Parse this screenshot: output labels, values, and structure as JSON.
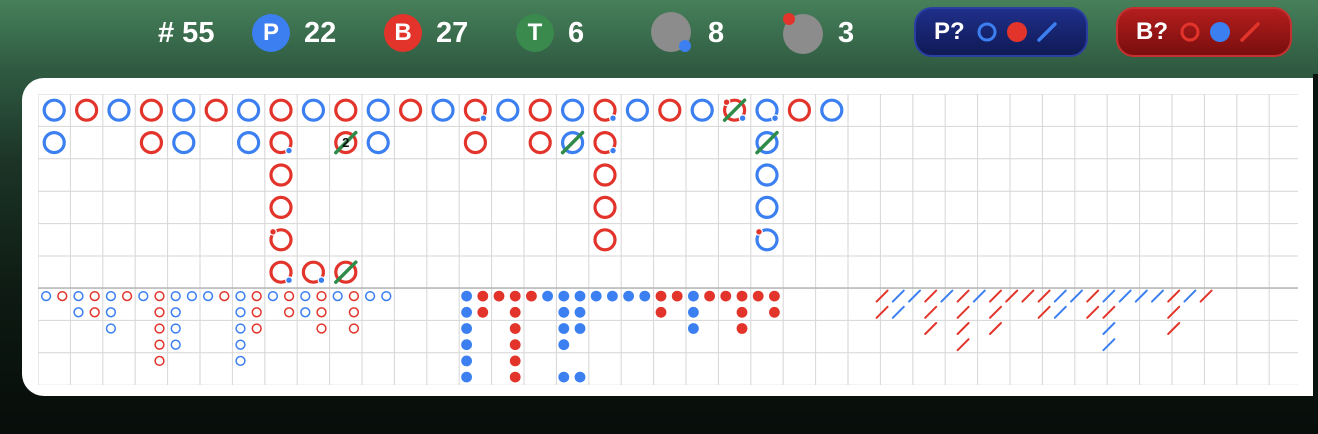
{
  "header": {
    "round": {
      "label": "# 55"
    },
    "player": {
      "badge": "P",
      "count": "22",
      "color": "#3b7ff1"
    },
    "banker": {
      "badge": "B",
      "count": "27",
      "color": "#e2342b"
    },
    "tie": {
      "badge": "T",
      "count": "6",
      "color": "#3a8a4d"
    },
    "player_pair": {
      "count": "8",
      "icon": "grey-disc-blue-dot-icon"
    },
    "banker_pair": {
      "count": "3",
      "icon": "grey-disc-red-dot-icon"
    },
    "predict_player": {
      "label": "P?",
      "icons": [
        "blue-ring-icon",
        "red-dot-icon",
        "blue-slash-icon"
      ]
    },
    "predict_banker": {
      "label": "B?",
      "icons": [
        "red-ring-icon",
        "blue-dot-icon",
        "red-slash-icon"
      ]
    }
  },
  "colors": {
    "player": "#3b7ff1",
    "banker": "#e2342b",
    "tie": "#2f8b49",
    "grid": "#d6d6d6"
  },
  "big_road": [
    {
      "c": 0,
      "r": 0,
      "s": "P"
    },
    {
      "c": 0,
      "r": 1,
      "s": "P"
    },
    {
      "c": 1,
      "r": 0,
      "s": "B"
    },
    {
      "c": 2,
      "r": 0,
      "s": "P"
    },
    {
      "c": 3,
      "r": 0,
      "s": "B"
    },
    {
      "c": 3,
      "r": 1,
      "s": "B"
    },
    {
      "c": 4,
      "r": 0,
      "s": "P"
    },
    {
      "c": 4,
      "r": 1,
      "s": "P"
    },
    {
      "c": 5,
      "r": 0,
      "s": "B"
    },
    {
      "c": 6,
      "r": 0,
      "s": "P"
    },
    {
      "c": 6,
      "r": 1,
      "s": "P"
    },
    {
      "c": 7,
      "r": 0,
      "s": "B"
    },
    {
      "c": 7,
      "r": 1,
      "s": "B",
      "pp": true
    },
    {
      "c": 7,
      "r": 2,
      "s": "B"
    },
    {
      "c": 7,
      "r": 3,
      "s": "B"
    },
    {
      "c": 7,
      "r": 4,
      "s": "B",
      "bp": true
    },
    {
      "c": 7,
      "r": 5,
      "s": "B",
      "pp": true
    },
    {
      "c": 8,
      "r": 0,
      "s": "P"
    },
    {
      "c": 8,
      "r": 5,
      "s": "B",
      "pp": true
    },
    {
      "c": 9,
      "r": 0,
      "s": "B"
    },
    {
      "c": 9,
      "r": 1,
      "s": "B",
      "tie": true,
      "ties": "2"
    },
    {
      "c": 9,
      "r": 5,
      "s": "B",
      "tie": true
    },
    {
      "c": 10,
      "r": 0,
      "s": "P"
    },
    {
      "c": 10,
      "r": 1,
      "s": "P"
    },
    {
      "c": 11,
      "r": 0,
      "s": "B"
    },
    {
      "c": 12,
      "r": 0,
      "s": "P"
    },
    {
      "c": 13,
      "r": 0,
      "s": "B",
      "pp": true
    },
    {
      "c": 13,
      "r": 1,
      "s": "B"
    },
    {
      "c": 14,
      "r": 0,
      "s": "P"
    },
    {
      "c": 15,
      "r": 0,
      "s": "B"
    },
    {
      "c": 15,
      "r": 1,
      "s": "B"
    },
    {
      "c": 16,
      "r": 0,
      "s": "P"
    },
    {
      "c": 16,
      "r": 1,
      "s": "P",
      "tie": true
    },
    {
      "c": 17,
      "r": 0,
      "s": "B",
      "pp": true
    },
    {
      "c": 17,
      "r": 1,
      "s": "B",
      "pp": true
    },
    {
      "c": 17,
      "r": 2,
      "s": "B"
    },
    {
      "c": 17,
      "r": 3,
      "s": "B"
    },
    {
      "c": 17,
      "r": 4,
      "s": "B"
    },
    {
      "c": 18,
      "r": 0,
      "s": "P"
    },
    {
      "c": 19,
      "r": 0,
      "s": "B"
    },
    {
      "c": 20,
      "r": 0,
      "s": "P"
    },
    {
      "c": 21,
      "r": 0,
      "s": "B",
      "tie": true,
      "pp": true,
      "bp": true
    },
    {
      "c": 22,
      "r": 0,
      "s": "P",
      "pp": true
    },
    {
      "c": 22,
      "r": 1,
      "s": "P",
      "tie": true
    },
    {
      "c": 22,
      "r": 2,
      "s": "P"
    },
    {
      "c": 22,
      "r": 3,
      "s": "P"
    },
    {
      "c": 22,
      "r": 4,
      "s": "P",
      "bp": true
    },
    {
      "c": 23,
      "r": 0,
      "s": "B"
    },
    {
      "c": 24,
      "r": 0,
      "s": "P"
    }
  ],
  "big_eye_boy": [
    {
      "c": 0,
      "r": 0,
      "s": "P"
    },
    {
      "c": 1,
      "r": 0,
      "s": "B"
    },
    {
      "c": 2,
      "r": 0,
      "s": "P"
    },
    {
      "c": 2,
      "r": 1,
      "s": "P"
    },
    {
      "c": 3,
      "r": 0,
      "s": "B"
    },
    {
      "c": 3,
      "r": 1,
      "s": "B"
    },
    {
      "c": 4,
      "r": 0,
      "s": "P"
    },
    {
      "c": 4,
      "r": 1,
      "s": "P"
    },
    {
      "c": 4,
      "r": 2,
      "s": "P"
    },
    {
      "c": 5,
      "r": 0,
      "s": "B"
    },
    {
      "c": 6,
      "r": 0,
      "s": "P"
    },
    {
      "c": 7,
      "r": 0,
      "s": "B"
    },
    {
      "c": 7,
      "r": 1,
      "s": "B"
    },
    {
      "c": 7,
      "r": 2,
      "s": "B"
    },
    {
      "c": 7,
      "r": 3,
      "s": "B"
    },
    {
      "c": 7,
      "r": 4,
      "s": "B"
    },
    {
      "c": 8,
      "r": 0,
      "s": "P"
    },
    {
      "c": 8,
      "r": 1,
      "s": "P"
    },
    {
      "c": 8,
      "r": 2,
      "s": "P"
    },
    {
      "c": 8,
      "r": 3,
      "s": "P"
    },
    {
      "c": 9,
      "r": 0,
      "s": "P"
    },
    {
      "c": 10,
      "r": 0,
      "s": "P"
    },
    {
      "c": 11,
      "r": 0,
      "s": "B"
    },
    {
      "c": 12,
      "r": 0,
      "s": "P"
    },
    {
      "c": 12,
      "r": 1,
      "s": "P"
    },
    {
      "c": 12,
      "r": 2,
      "s": "P"
    },
    {
      "c": 12,
      "r": 3,
      "s": "P"
    },
    {
      "c": 12,
      "r": 4,
      "s": "P"
    },
    {
      "c": 13,
      "r": 0,
      "s": "B"
    },
    {
      "c": 13,
      "r": 1,
      "s": "B"
    },
    {
      "c": 13,
      "r": 2,
      "s": "B"
    },
    {
      "c": 14,
      "r": 0,
      "s": "P"
    },
    {
      "c": 15,
      "r": 0,
      "s": "B"
    },
    {
      "c": 15,
      "r": 1,
      "s": "B"
    },
    {
      "c": 16,
      "r": 0,
      "s": "P"
    },
    {
      "c": 16,
      "r": 1,
      "s": "P"
    },
    {
      "c": 17,
      "r": 0,
      "s": "B"
    },
    {
      "c": 17,
      "r": 1,
      "s": "B"
    },
    {
      "c": 17,
      "r": 2,
      "s": "B"
    },
    {
      "c": 18,
      "r": 0,
      "s": "P"
    },
    {
      "c": 19,
      "r": 0,
      "s": "B"
    },
    {
      "c": 19,
      "r": 1,
      "s": "B"
    },
    {
      "c": 19,
      "r": 2,
      "s": "B"
    },
    {
      "c": 20,
      "r": 0,
      "s": "P"
    },
    {
      "c": 21,
      "r": 0,
      "s": "P"
    }
  ],
  "small_road": [
    {
      "c": 0,
      "r": 0,
      "s": "P"
    },
    {
      "c": 0,
      "r": 1,
      "s": "P"
    },
    {
      "c": 0,
      "r": 2,
      "s": "P"
    },
    {
      "c": 0,
      "r": 3,
      "s": "P"
    },
    {
      "c": 0,
      "r": 4,
      "s": "P"
    },
    {
      "c": 0,
      "r": 5,
      "s": "P"
    },
    {
      "c": 1,
      "r": 0,
      "s": "B"
    },
    {
      "c": 1,
      "r": 1,
      "s": "B"
    },
    {
      "c": 2,
      "r": 0,
      "s": "B"
    },
    {
      "c": 3,
      "r": 0,
      "s": "B"
    },
    {
      "c": 3,
      "r": 1,
      "s": "B"
    },
    {
      "c": 3,
      "r": 2,
      "s": "B"
    },
    {
      "c": 3,
      "r": 3,
      "s": "B"
    },
    {
      "c": 3,
      "r": 4,
      "s": "B"
    },
    {
      "c": 3,
      "r": 5,
      "s": "B"
    },
    {
      "c": 4,
      "r": 0,
      "s": "B"
    },
    {
      "c": 5,
      "r": 0,
      "s": "P"
    },
    {
      "c": 6,
      "r": 0,
      "s": "P"
    },
    {
      "c": 6,
      "r": 1,
      "s": "P"
    },
    {
      "c": 6,
      "r": 2,
      "s": "P"
    },
    {
      "c": 6,
      "r": 3,
      "s": "P"
    },
    {
      "c": 6,
      "r": 5,
      "s": "P"
    },
    {
      "c": 7,
      "r": 0,
      "s": "P"
    },
    {
      "c": 7,
      "r": 1,
      "s": "P"
    },
    {
      "c": 7,
      "r": 2,
      "s": "P"
    },
    {
      "c": 7,
      "r": 5,
      "s": "P"
    },
    {
      "c": 8,
      "r": 0,
      "s": "P"
    },
    {
      "c": 9,
      "r": 0,
      "s": "P"
    },
    {
      "c": 10,
      "r": 0,
      "s": "P"
    },
    {
      "c": 11,
      "r": 0,
      "s": "P"
    },
    {
      "c": 12,
      "r": 0,
      "s": "B"
    },
    {
      "c": 12,
      "r": 1,
      "s": "B"
    },
    {
      "c": 13,
      "r": 0,
      "s": "B"
    },
    {
      "c": 14,
      "r": 0,
      "s": "P"
    },
    {
      "c": 14,
      "r": 1,
      "s": "P"
    },
    {
      "c": 14,
      "r": 2,
      "s": "P"
    },
    {
      "c": 15,
      "r": 0,
      "s": "B"
    },
    {
      "c": 16,
      "r": 0,
      "s": "B"
    },
    {
      "c": 17,
      "r": 0,
      "s": "B"
    },
    {
      "c": 17,
      "r": 1,
      "s": "B"
    },
    {
      "c": 17,
      "r": 2,
      "s": "B"
    },
    {
      "c": 18,
      "r": 0,
      "s": "B"
    },
    {
      "c": 19,
      "r": 0,
      "s": "B"
    },
    {
      "c": 19,
      "r": 1,
      "s": "B"
    }
  ],
  "cockroach_road": [
    {
      "c": 0,
      "r": 0,
      "s": "B"
    },
    {
      "c": 0,
      "r": 1,
      "s": "B"
    },
    {
      "c": 1,
      "r": 0,
      "s": "P"
    },
    {
      "c": 1,
      "r": 1,
      "s": "P"
    },
    {
      "c": 2,
      "r": 0,
      "s": "P"
    },
    {
      "c": 3,
      "r": 0,
      "s": "B"
    },
    {
      "c": 3,
      "r": 1,
      "s": "B"
    },
    {
      "c": 3,
      "r": 2,
      "s": "B"
    },
    {
      "c": 4,
      "r": 0,
      "s": "P"
    },
    {
      "c": 5,
      "r": 0,
      "s": "B"
    },
    {
      "c": 5,
      "r": 1,
      "s": "B"
    },
    {
      "c": 5,
      "r": 2,
      "s": "B"
    },
    {
      "c": 5,
      "r": 3,
      "s": "B"
    },
    {
      "c": 6,
      "r": 0,
      "s": "P"
    },
    {
      "c": 7,
      "r": 0,
      "s": "B"
    },
    {
      "c": 7,
      "r": 1,
      "s": "B"
    },
    {
      "c": 7,
      "r": 2,
      "s": "B"
    },
    {
      "c": 8,
      "r": 0,
      "s": "B"
    },
    {
      "c": 9,
      "r": 0,
      "s": "B"
    },
    {
      "c": 10,
      "r": 0,
      "s": "B"
    },
    {
      "c": 10,
      "r": 1,
      "s": "B"
    },
    {
      "c": 11,
      "r": 0,
      "s": "P"
    },
    {
      "c": 11,
      "r": 1,
      "s": "P"
    },
    {
      "c": 12,
      "r": 0,
      "s": "P"
    },
    {
      "c": 13,
      "r": 0,
      "s": "B"
    },
    {
      "c": 13,
      "r": 1,
      "s": "B"
    },
    {
      "c": 14,
      "r": 0,
      "s": "P"
    },
    {
      "c": 14,
      "r": 1,
      "s": "B"
    },
    {
      "c": 14,
      "r": 2,
      "s": "P"
    },
    {
      "c": 14,
      "r": 3,
      "s": "P"
    },
    {
      "c": 15,
      "r": 0,
      "s": "P"
    },
    {
      "c": 16,
      "r": 0,
      "s": "P"
    },
    {
      "c": 17,
      "r": 0,
      "s": "P"
    },
    {
      "c": 18,
      "r": 0,
      "s": "B"
    },
    {
      "c": 18,
      "r": 1,
      "s": "B"
    },
    {
      "c": 18,
      "r": 2,
      "s": "B"
    },
    {
      "c": 19,
      "r": 0,
      "s": "P"
    },
    {
      "c": 20,
      "r": 0,
      "s": "B"
    }
  ]
}
